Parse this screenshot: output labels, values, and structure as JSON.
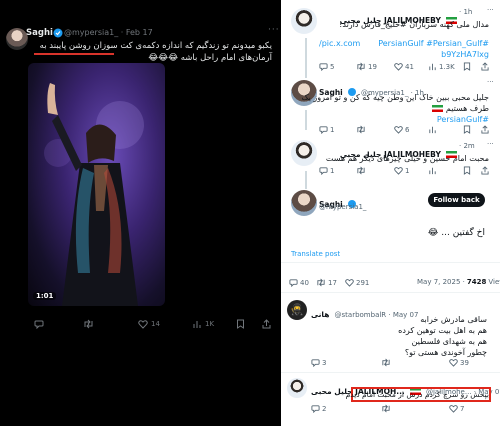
{
  "left_post": {
    "name": "Saghi",
    "handle": "@mypersia1_ · Feb 17",
    "more": "···",
    "text": "یکبو میدونم تو زندگیم که اندازه دکمه‌ی کت سوزان روشن پایبند به آرمان‌های امام راحل باشه 😂😂😂",
    "video_time": "1:01",
    "actions": {
      "retweets": "",
      "likes": "14",
      "views": "1K"
    }
  },
  "thread": {
    "post1": {
      "name": "جلیل محبی JALILMOHEBY",
      "time": "· 1h",
      "text_line1": "مدال ملی کهنه سربازان #خلیج_فارس دارند!",
      "link": "pic.x.com/",
      "hashtags_line1": "#PersianGulf #Persian_Gulf",
      "hashtags_line2": "b9YzHA7lxg",
      "replies": "5",
      "retweets": "19",
      "likes": "41",
      "views": "1.3K"
    },
    "post2": {
      "name": "Saghi",
      "handle": "@mypersia1_ · 1h",
      "text_line1": "جلیل محبی ببین خاک این وطن چیه که کن و تو امروز یک",
      "text_line2": "طرف هستیم",
      "hashtag": "#PersianGulf",
      "replies": "1",
      "likes": "6"
    },
    "post3": {
      "name": "جلیل محبی JALILMOHEBY",
      "time": "· 2m",
      "text": "محبت امام حسین و خیلی چیزهای دیگر هم هست",
      "replies": "1",
      "likes": "1"
    },
    "post4": {
      "name": "Saghi",
      "handle": "@mypersia1_",
      "follow_label": "Follow back",
      "text": "اخ گفتین ... 😂",
      "translate": "Translate post",
      "timestamp": "May 7, 2025 ·",
      "views_count": "7428",
      "views_label": "Views",
      "replies": "40",
      "retweets": "17",
      "likes": "291"
    },
    "reply1": {
      "name": "هانی",
      "handle": "@starbombalR · May 07",
      "line1": "ساقی مادرش خرابه",
      "line2": "هم به اهل بیت توهین کرده",
      "line3": "هم به شهدای فلسطین",
      "line4": "چطور آخوندی هستی تو؟",
      "replies": "3",
      "likes": "39"
    },
    "reply2": {
      "name": "جلیل محبی JALILMOH...",
      "handle": "@jalilmohe... · May 07",
      "text": "بپخش رو سرچ کردم درش از محبت امام دیدم",
      "replies": "2",
      "likes": "7"
    }
  },
  "colors": {
    "accent": "#1d9bf0",
    "highlight": "#e0281c",
    "dark_bg": "#000000"
  }
}
